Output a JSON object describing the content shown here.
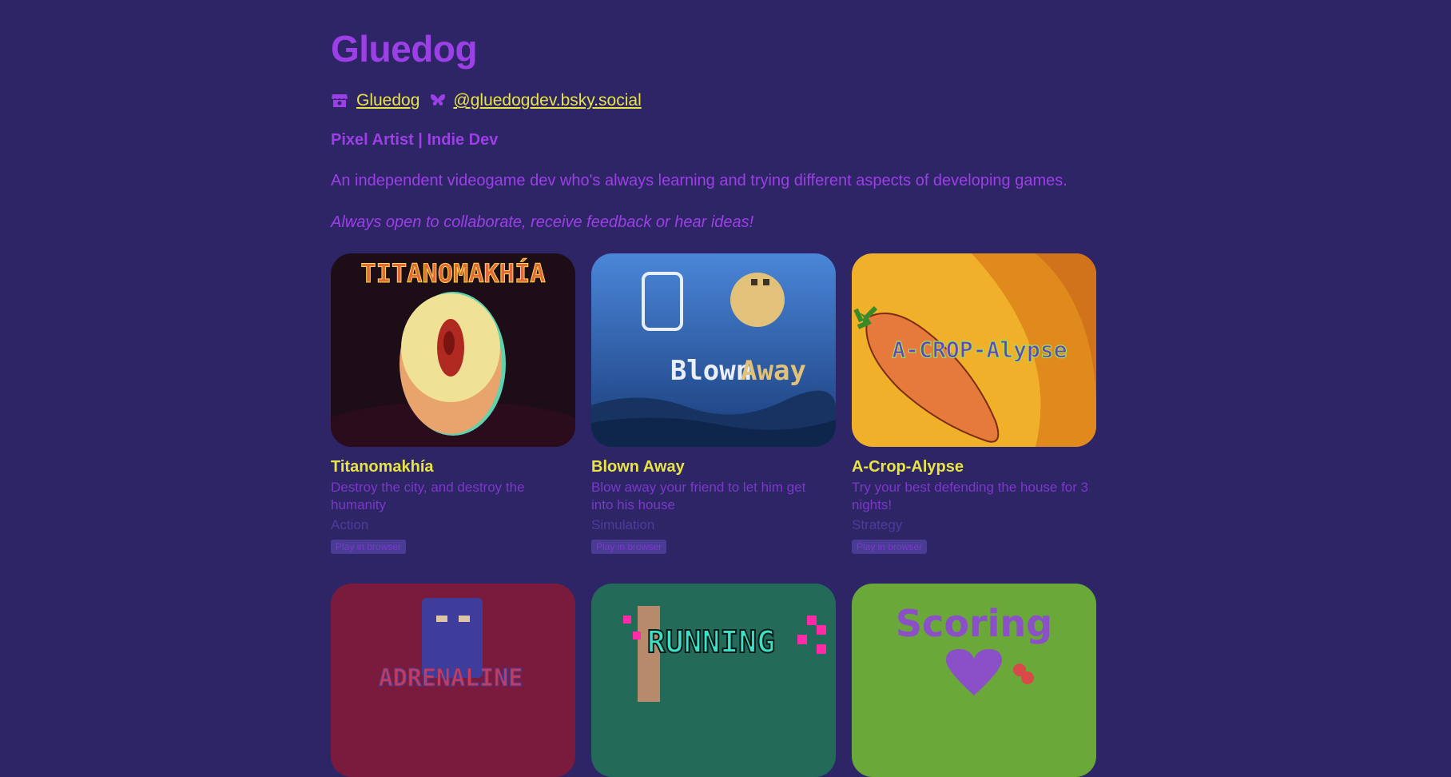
{
  "profile": {
    "name": "Gluedog",
    "itch_link": "Gluedog",
    "bsky_link": "@gluedogdev.bsky.social",
    "tagline": "Pixel Artist | Indie Dev",
    "description": "An independent videogame dev who's always learning and trying different aspects of developing games.",
    "collab": "Always open to collaborate, receive feedback or hear ideas!"
  },
  "icons": {
    "itch": "itch-store-icon",
    "bsky": "butterfly-icon"
  },
  "games": [
    {
      "title": "Titanomakhía",
      "desc": "Destroy the city, and destroy the humanity",
      "genre": "Action",
      "badge": "Play in browser",
      "art_text": "TITANOMAKHÍA"
    },
    {
      "title": "Blown Away",
      "desc": "Blow away your friend to let him get into his house",
      "genre": "Simulation",
      "badge": "Play in browser",
      "art_text_a": "Blown",
      "art_text_b": "Away"
    },
    {
      "title": "A-Crop-Alypse",
      "desc": "Try your best defending the house for 3 nights!",
      "genre": "Strategy",
      "badge": "Play in browser",
      "art_text": "A-CROP-Alypse"
    },
    {
      "art_text": "ADRENALINE"
    },
    {
      "art_text": "RUNNING"
    },
    {
      "art_text": "Scoring"
    }
  ],
  "colors": {
    "bg": "#2d2566",
    "accent": "#9d3fe6",
    "link": "#e8e443"
  }
}
